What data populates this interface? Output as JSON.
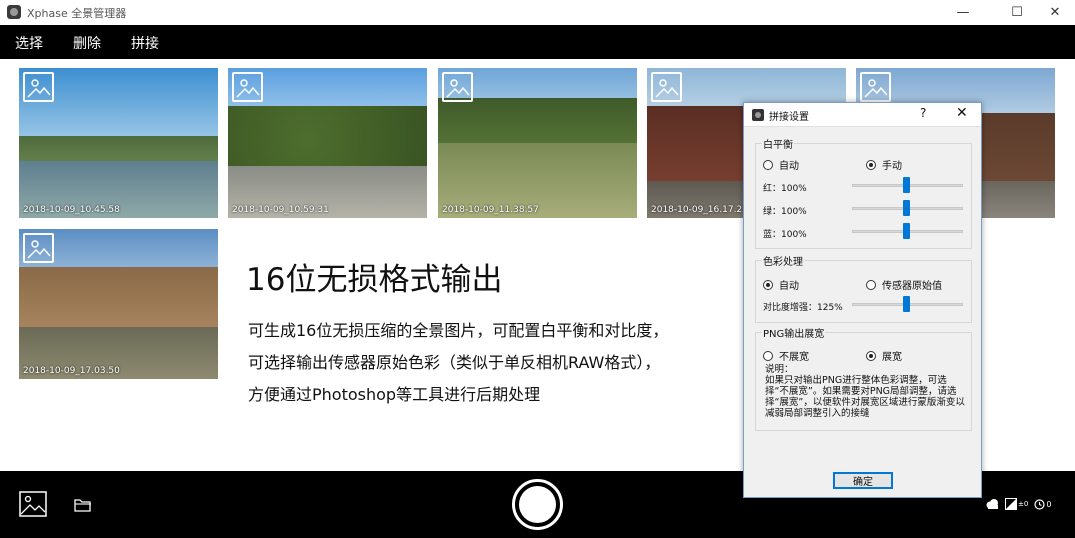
{
  "window": {
    "title": "Xphase 全景管理器",
    "minimize_glyph": "—",
    "maximize_glyph": "☐",
    "close_glyph": "✕"
  },
  "menu": {
    "select_label": "选择",
    "delete_label": "删除",
    "stitch_label": "拼接"
  },
  "thumbnails": [
    {
      "caption": "2018-10-09_10.45.58",
      "icon": "image-icon"
    },
    {
      "caption": "2018-10-09_10.59.31",
      "icon": "image-icon"
    },
    {
      "caption": "2018-10-09_11.38.57",
      "icon": "image-icon"
    },
    {
      "caption": "2018-10-09_16.17.2",
      "icon": "image-icon"
    },
    {
      "caption": "",
      "icon": "image-icon"
    },
    {
      "caption": "2018-10-09_17.03.50",
      "icon": "image-icon"
    }
  ],
  "feature": {
    "title": "16位无损格式输出",
    "line1": "可生成16位无损压缩的全景图片，可配置白平衡和对比度，",
    "line2": "可选择输出传感器原始色彩（类似于单反相机RAW格式），",
    "line3": "方便通过Photoshop等工具进行后期处理"
  },
  "bottom": {
    "gallery_icon": "gallery-icon",
    "folder_icon": "folder-icon",
    "shutter_icon": "shutter-button",
    "status": {
      "weather_icon": "cloud-icon",
      "exposure_label": "±0",
      "timer_label": "0"
    }
  },
  "dialog": {
    "title": "拼接设置",
    "help_glyph": "?",
    "close_glyph": "✕",
    "white_balance": {
      "title": "白平衡",
      "auto_label": "自动",
      "manual_label": "手动",
      "selected": "manual",
      "red_label": "红：100%",
      "green_label": "绿：100%",
      "blue_label": "蓝：100%",
      "red_value": 100,
      "green_value": 100,
      "blue_value": 100
    },
    "color": {
      "title": "色彩处理",
      "auto_label": "自动",
      "raw_label": "传感器原始值",
      "selected": "auto",
      "contrast_label": "对比度增强：125%",
      "contrast_value": 125
    },
    "png": {
      "title": "PNG输出展宽",
      "no_expand_label": "不展宽",
      "expand_label": "展宽",
      "selected": "expand",
      "note": "说明：\n如果只对输出PNG进行整体色彩调整，可选择“不展宽”。如果需要对PNG局部调整，请选择“展宽”，以便软件对展宽区域进行蒙版渐变以减弱局部调整引入的接缝"
    },
    "ok_label": "确定"
  },
  "colors": {
    "bar_bg": "#000000",
    "accent": "#0078d7",
    "dialog_bg": "#f0f0f0"
  }
}
